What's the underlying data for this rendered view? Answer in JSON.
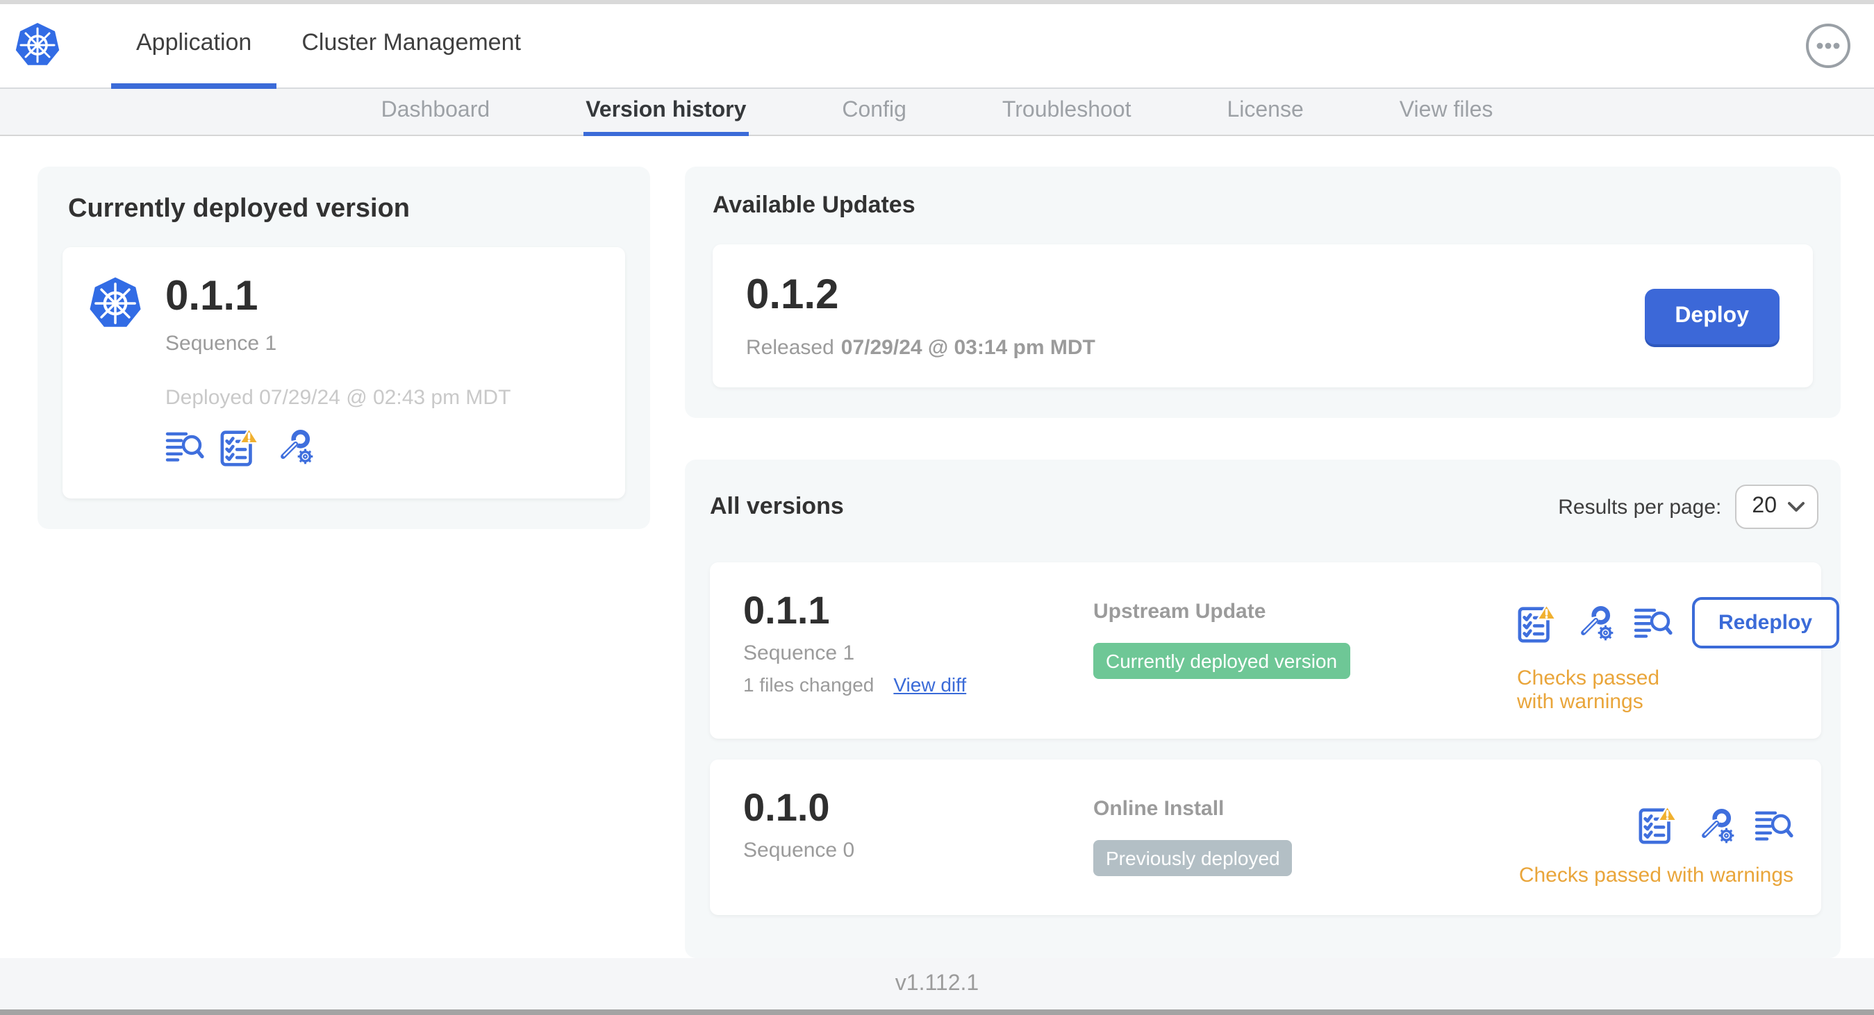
{
  "header": {
    "tabs": [
      {
        "label": "Application",
        "active": true
      },
      {
        "label": "Cluster Management",
        "active": false
      }
    ]
  },
  "subnav": {
    "tabs": [
      {
        "label": "Dashboard",
        "active": false
      },
      {
        "label": "Version history",
        "active": true
      },
      {
        "label": "Config",
        "active": false
      },
      {
        "label": "Troubleshoot",
        "active": false
      },
      {
        "label": "License",
        "active": false
      },
      {
        "label": "View files",
        "active": false
      }
    ]
  },
  "current_version": {
    "title": "Currently deployed version",
    "version": "0.1.1",
    "sequence": "Sequence 1",
    "deployed": "Deployed 07/29/24 @ 02:43 pm MDT",
    "icons": [
      "diff-icon",
      "preflight-checks-warning-icon",
      "config-icon"
    ]
  },
  "available_updates": {
    "title": "Available Updates",
    "version": "0.1.2",
    "released_label": "Released",
    "released_date": "07/29/24 @ 03:14 pm MDT",
    "deploy_button": "Deploy"
  },
  "all_versions": {
    "title": "All versions",
    "results_per_page_label": "Results per page:",
    "results_per_page_value": "20",
    "rows": [
      {
        "version": "0.1.1",
        "sequence": "Sequence 1",
        "files_changed": "1 files changed",
        "view_diff_link": "View diff",
        "source": "Upstream Update",
        "badge": "Currently deployed version",
        "badge_style": "green",
        "checks_status": "Checks passed with warnings",
        "action_button": "Redeploy"
      },
      {
        "version": "0.1.0",
        "sequence": "Sequence 0",
        "source": "Online Install",
        "badge": "Previously deployed",
        "badge_style": "gray",
        "checks_status": "Checks passed with warnings"
      }
    ]
  },
  "footer": {
    "app_version": "v1.112.1"
  },
  "colors": {
    "accent_blue": "#3b6bd8",
    "kubernetes_blue": "#326ce5",
    "badge_green": "#6ec796",
    "badge_gray": "#b3bfc5",
    "warning_amber": "#eca937",
    "section_bg": "#f5f8f9"
  }
}
